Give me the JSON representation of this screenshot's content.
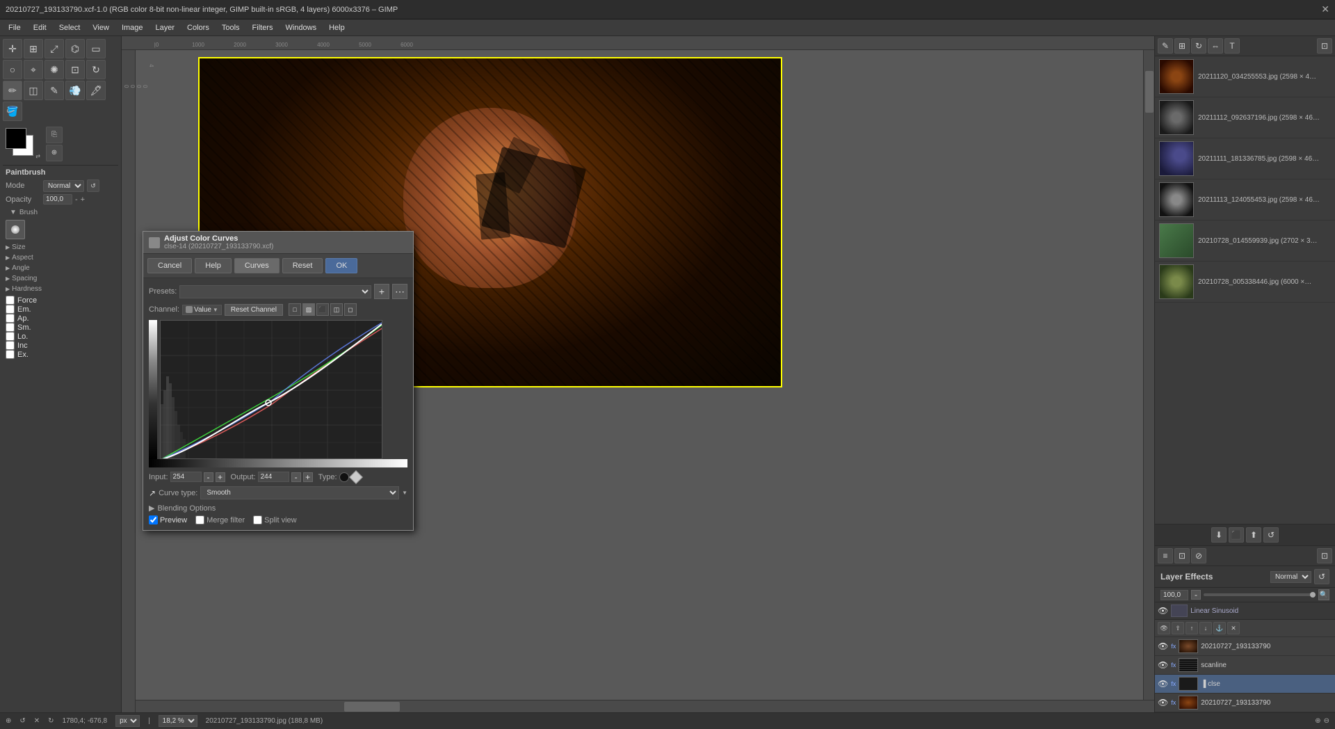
{
  "window": {
    "title": "20210727_193133790.xcf-1.0 (RGB color 8-bit non-linear integer, GIMP built-in sRGB, 4 layers) 6000x3376 – GIMP",
    "close_label": "✕"
  },
  "menubar": {
    "items": [
      "File",
      "Edit",
      "Select",
      "View",
      "Image",
      "Layer",
      "Colors",
      "Tools",
      "Filters",
      "Windows",
      "Help"
    ]
  },
  "toolbox": {
    "tool_name": "Paintbrush",
    "mode_label": "Mode",
    "mode_value": "Normal",
    "opacity_label": "Opacity",
    "opacity_value": "100,0",
    "brush_label": "Brush",
    "size_label": "Size",
    "angle_label": "Angle",
    "spacing_label": "Spacing",
    "hardness_label": "Hardness",
    "force_label": "Force",
    "emit_label": "Em.",
    "apply_label": "Ap.",
    "smooth_label": "Sm.",
    "lock_label": "Lo.",
    "inc_label": "Inc",
    "exp_label": "Ex."
  },
  "curves_dialog": {
    "title": "Adjust Color Curves",
    "subtitle": "clse-14 (20210727_193133790.xcf)",
    "cancel_label": "Cancel",
    "help_label": "Help",
    "curves_label": "Curves",
    "reset_label": "Reset",
    "ok_label": "OK",
    "presets_label": "Presets:",
    "channel_label": "Channel:",
    "channel_value": "Value",
    "reset_channel_label": "Reset Channel",
    "input_label": "Input:",
    "input_value": "254",
    "output_label": "Output:",
    "output_value": "244",
    "type_label": "Type:",
    "curve_type_label": "Curve type:",
    "curve_type_value": "Smooth",
    "blending_options_label": "Blending Options",
    "preview_label": "Preview",
    "merge_filter_label": "Merge filter",
    "split_view_label": "Split view"
  },
  "right_panel": {
    "thumbnails": [
      {
        "label": "20211120_034255553.jpg (2598 × 4",
        "bg_class": "thumb-img-inner"
      },
      {
        "label": "20211112_092637196.jpg (2598 × 46",
        "bg_class": "thumb-img-inner2"
      },
      {
        "label": "20211111_181336785.jpg (2598 × 46",
        "bg_class": "thumb-img-inner3"
      },
      {
        "label": "20211113_124055453.jpg (2598 × 46",
        "bg_class": "thumb-img-inner4"
      },
      {
        "label": "20210728_014559939.jpg (2702 × 3",
        "bg_class": "thumb-img-inner5"
      },
      {
        "label": "20210728_005338446.jpg (6000 ×",
        "bg_class": "thumb-img-inner6"
      }
    ],
    "layer_effects_label": "Layer Effects",
    "layer_effects_mode": "Normal",
    "layer_effects_opacity": "100,0",
    "layer_linear_sinusoid": "Linear Sinusoid",
    "layers": [
      {
        "name": "20210727_193133790",
        "visible": true,
        "fx": true,
        "selected": false
      },
      {
        "name": "scanline",
        "visible": true,
        "fx": true,
        "selected": false
      },
      {
        "name": "clse",
        "visible": true,
        "fx": true,
        "selected": true
      },
      {
        "name": "20210727_193133790",
        "visible": true,
        "fx": true,
        "selected": false
      }
    ]
  },
  "statusbar": {
    "coords": "1780,4; -676,8",
    "units": "px",
    "zoom": "18,2 %",
    "filename": "20210727_193133790.jpg (188,8 MB)"
  },
  "ruler": {
    "top_marks": [
      "0",
      "1000",
      "2000",
      "3000",
      "4000",
      "5000",
      "6000"
    ],
    "left_marks": [
      "0",
      "4",
      "0",
      "0",
      "0"
    ]
  }
}
